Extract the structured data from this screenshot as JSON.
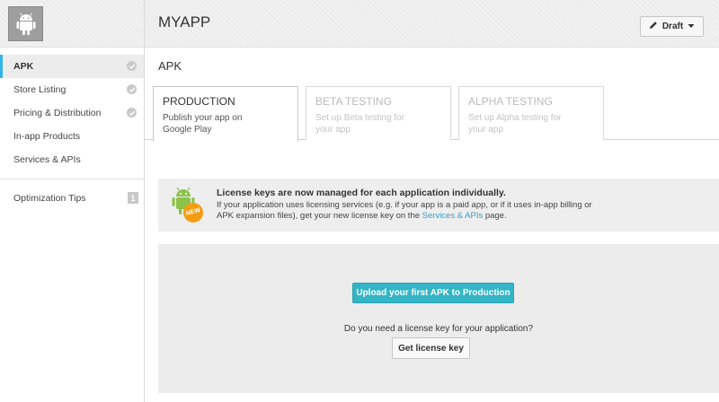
{
  "header": {
    "app_title": "MYAPP",
    "draft_label": "Draft"
  },
  "sidebar": {
    "items": [
      {
        "label": "APK",
        "active": true,
        "checked": true
      },
      {
        "label": "Store Listing",
        "checked": true
      },
      {
        "label": "Pricing & Distribution",
        "checked": true
      },
      {
        "label": "In-app Products",
        "checked": false
      },
      {
        "label": "Services & APIs",
        "checked": false
      }
    ],
    "optimization": {
      "label": "Optimization Tips",
      "count": "1"
    }
  },
  "main": {
    "heading": "APK",
    "tabs": [
      {
        "title": "PRODUCTION",
        "desc": "Publish your app on Google Play",
        "active": true
      },
      {
        "title": "BETA TESTING",
        "desc": "Set up Beta testing for your app",
        "active": false
      },
      {
        "title": "ALPHA TESTING",
        "desc": "Set up Alpha testing for your app",
        "active": false
      }
    ],
    "notice": {
      "badge": "NEW",
      "title": "License keys are now managed for each application individually.",
      "body_before": "If your application uses licensing services (e.g. if your app is a paid app, or if it uses in-app billing or APK expansion files), get your new license key on the ",
      "link": "Services & APIs",
      "body_after": " page."
    },
    "upload": {
      "button_label": "Upload your first APK to Production",
      "question": "Do you need a license key for your application?",
      "license_button_label": "Get license key"
    }
  },
  "colors": {
    "accent": "#33b5e5",
    "upload_button": "#33b5c5",
    "android_green": "#8bc34a",
    "badge_orange": "#f39c12"
  },
  "icons": {
    "app": "android-icon",
    "draft": "pencil-icon",
    "dropdown": "caret-down-icon",
    "check": "check-circle-icon",
    "notice": "android-new-icon"
  }
}
